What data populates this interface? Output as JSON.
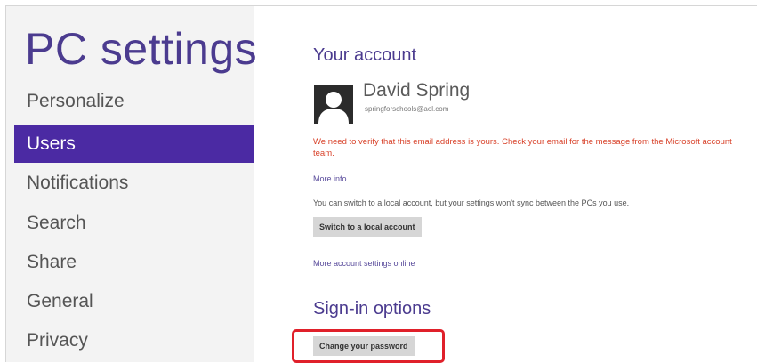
{
  "sidebar": {
    "title": "PC settings",
    "items": [
      {
        "label": "Personalize"
      },
      {
        "label": "Users"
      },
      {
        "label": "Notifications"
      },
      {
        "label": "Search"
      },
      {
        "label": "Share"
      },
      {
        "label": "General"
      },
      {
        "label": "Privacy"
      }
    ],
    "selected": "Users"
  },
  "account": {
    "heading": "Your account",
    "avatar_icon": "user-silhouette-icon",
    "name": "David Spring",
    "email": "springforschools@aol.com",
    "warning": "We need to verify that this email address is yours. Check your email for the message from the Microsoft account team.",
    "more_info": "More info",
    "local_account_info": "You can switch to a local account, but your settings won't sync between the PCs you use.",
    "switch_button": "Switch to a local account",
    "more_settings_link": "More account settings online"
  },
  "signin": {
    "heading": "Sign-in options",
    "change_password_button": "Change your password"
  },
  "colors": {
    "accent": "#4b2aa3",
    "title": "#4b3b8f",
    "warning": "#d8422a",
    "highlight": "#e0202a"
  }
}
